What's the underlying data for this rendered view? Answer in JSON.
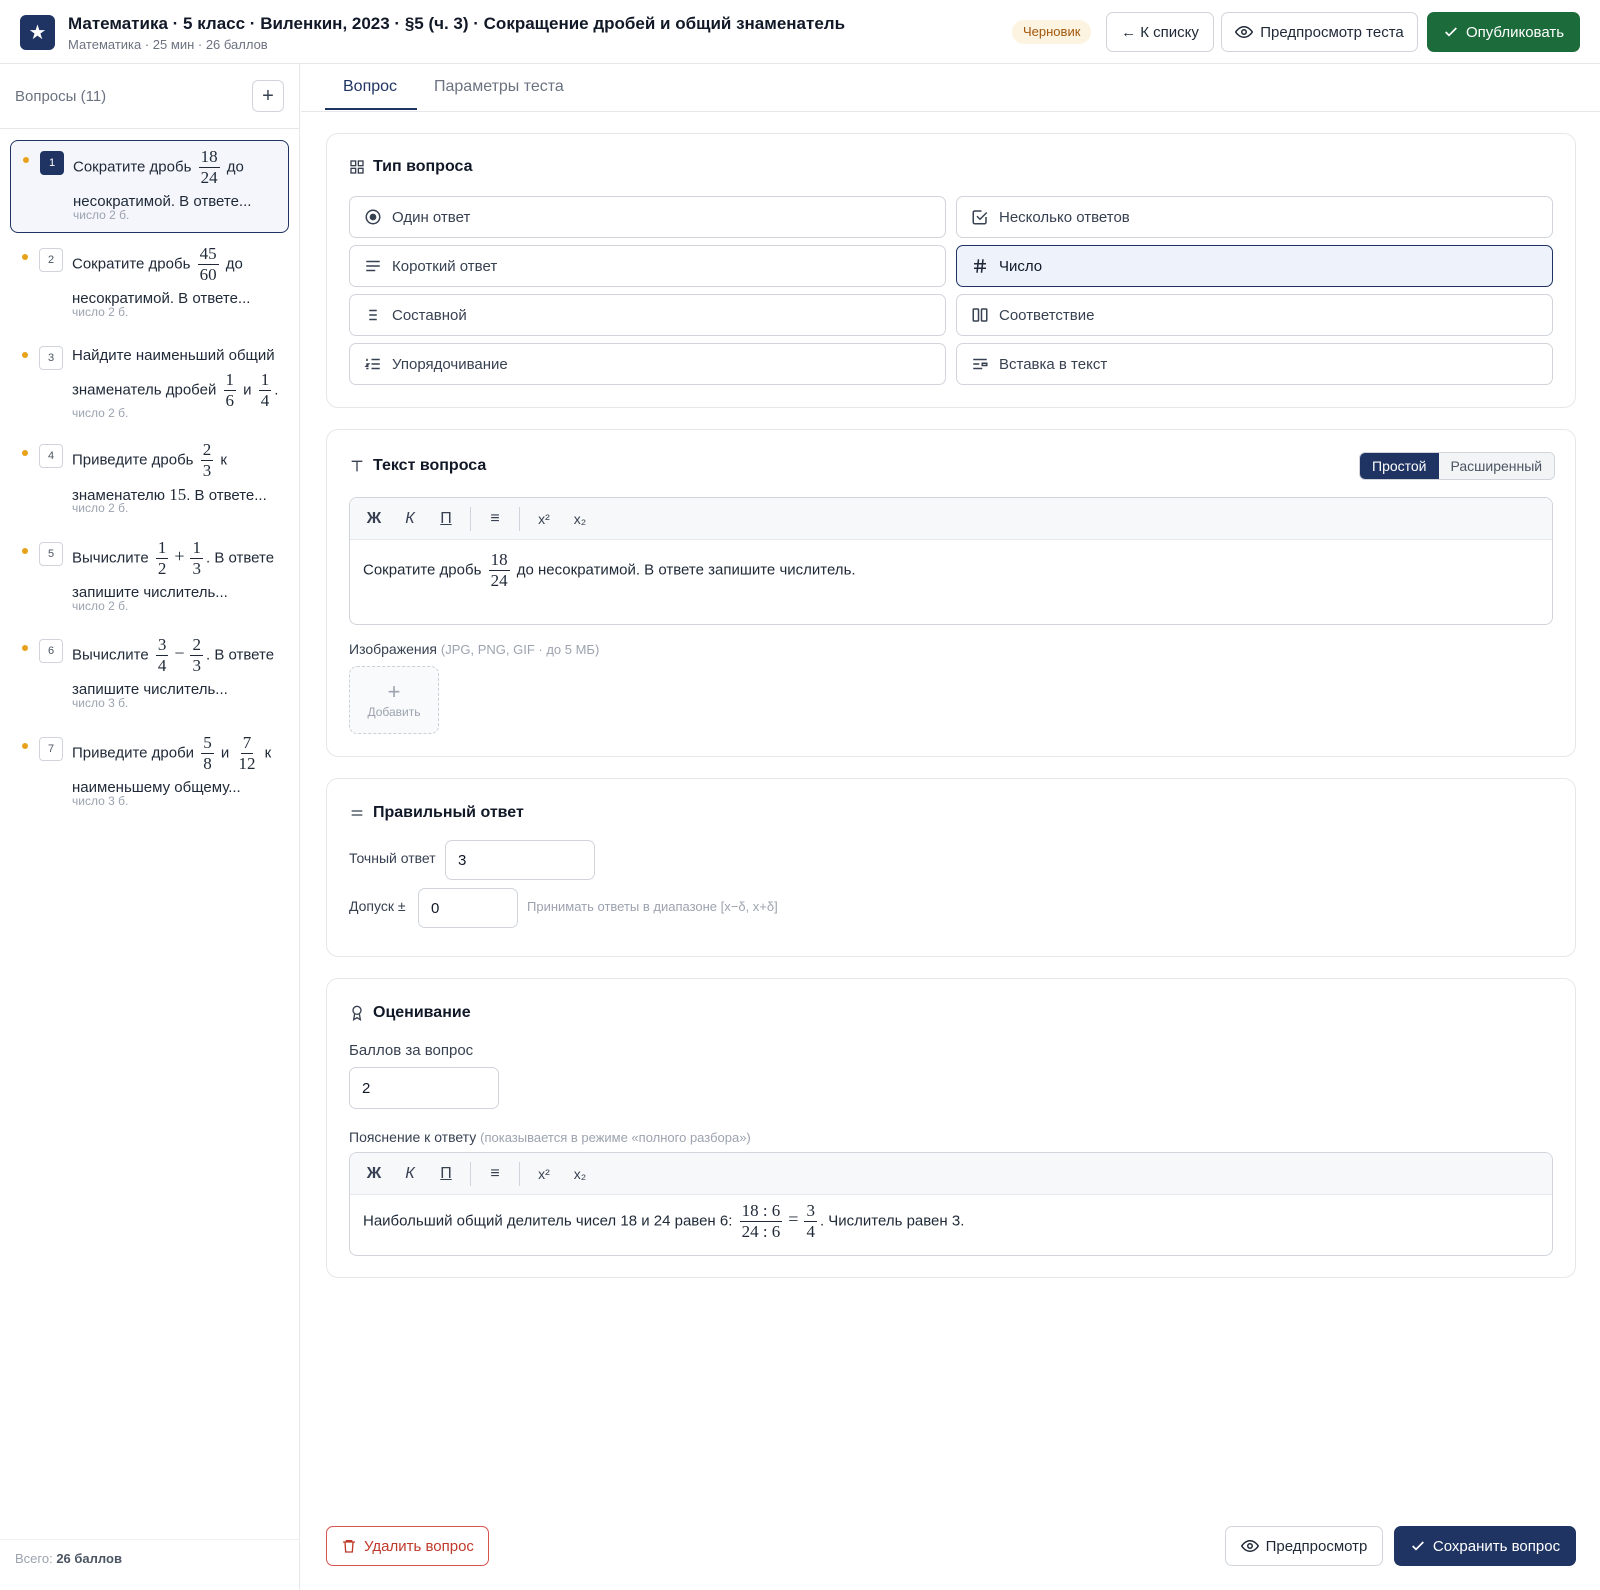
{
  "header": {
    "title": "Математика · 5 класс · Виленкин, 2023 · §5 (ч. 3) · Сокращение дробей и общий знаменатель",
    "subtitle": "Математика · 25 мин · 26 баллов",
    "badge": "Черновик",
    "back_label": "← К списку",
    "preview_test_label": "Предпросмотр теста",
    "publish_label": "Опубликовать"
  },
  "sidebar": {
    "heading": "Вопросы (11)",
    "add_label": "+",
    "total_prefix": "Всего:",
    "total_value": "26 баллов",
    "items": [
      {
        "num": "1",
        "t1": "Сократите дробь",
        "fn": "18",
        "fd": "24",
        "t2": "до",
        "t3": "несократимой. В ответе...",
        "meta": "число  2 б."
      },
      {
        "num": "2",
        "t1": "Сократите дробь",
        "fn": "45",
        "fd": "60",
        "t2": "до",
        "t3": "несократимой. В ответе...",
        "meta": "число  2 б."
      },
      {
        "num": "3",
        "t1": "Найдите наименьший общий знаменатель дробей",
        "f1n": "1",
        "f1d": "6",
        "and": "и",
        "f2n": "1",
        "f2d": "4",
        "end": ".",
        "meta": "число  2 б."
      },
      {
        "num": "4",
        "t1": "Приведите дробь",
        "fn": "2",
        "fd": "3",
        "t2": "к",
        "t3": "знаменателю",
        "n": "15",
        "t4": ". В ответе...",
        "meta": "число  2 б."
      },
      {
        "num": "5",
        "t1": "Вычислите",
        "f1n": "1",
        "f1d": "2",
        "op": "+",
        "f2n": "1",
        "f2d": "3",
        "t2": ". В ответе",
        "t3": "запишите числитель...",
        "meta": "число  2 б."
      },
      {
        "num": "6",
        "t1": "Вычислите",
        "f1n": "3",
        "f1d": "4",
        "op": "−",
        "f2n": "2",
        "f2d": "3",
        "t2": ". В ответе",
        "t3": "запишите числитель...",
        "meta": "число  3 б."
      },
      {
        "num": "7",
        "t1": "Приведите дроби",
        "f1n": "5",
        "f1d": "8",
        "and": "и",
        "f2n": "7",
        "f2d": "12",
        "t2": "к",
        "t3": "наименьшему общему...",
        "meta": "число  3 б."
      }
    ]
  },
  "tabs": {
    "question": "Вопрос",
    "params": "Параметры теста"
  },
  "type_card": {
    "title": "Тип вопроса",
    "types": {
      "single": "Один ответ",
      "multiple": "Несколько ответов",
      "short": "Короткий ответ",
      "number": "Число",
      "compound": "Составной",
      "matching": "Соответствие",
      "ordering": "Упорядочивание",
      "insert": "Вставка в текст"
    },
    "selected": "number"
  },
  "text_card": {
    "title": "Текст вопроса",
    "mode_simple": "Простой",
    "mode_advanced": "Расширенный",
    "toolbar": {
      "bold": "Ж",
      "italic": "К",
      "underline": "П",
      "list": "≡",
      "sup": "x²",
      "sub": "x₂"
    },
    "body_before": "Сократите дробь",
    "body_fn": "18",
    "body_fd": "24",
    "body_after": "до несократимой. В ответе запишите числитель.",
    "images_label": "Изображения",
    "images_hint": "(JPG, PNG, GIF · до 5 МБ)",
    "add_image_plus": "+",
    "add_image_label": "Добавить"
  },
  "answer_card": {
    "title": "Правильный ответ",
    "exact_label": "Точный ответ",
    "exact_value": "3",
    "tolerance_label": "Допуск ±",
    "tolerance_value": "0",
    "tolerance_hint": "Принимать ответы в диапазоне [x−δ, x+δ]"
  },
  "grading_card": {
    "title": "Оценивание",
    "points_label": "Баллов за вопрос",
    "points_value": "2",
    "explanation_label": "Пояснение к ответу",
    "explanation_hint": "(показывается в режиме «полного разбора»)",
    "explanation_before": "Наибольший общий делитель чисел 18 и 24 равен 6:",
    "explanation_fn": "18 : 6",
    "explanation_fd": "24 : 6",
    "explanation_eq": "=",
    "explanation_rn": "3",
    "explanation_rd": "4",
    "explanation_after": ". Числитель равен 3."
  },
  "footer": {
    "delete_label": "Удалить вопрос",
    "preview_label": "Предпросмотр",
    "save_label": "Сохранить вопрос"
  },
  "colors": {
    "brand": "#1f3462",
    "publish": "#1c6b3b",
    "danger": "#c0392b",
    "draft_dot": "#e8a21a"
  }
}
